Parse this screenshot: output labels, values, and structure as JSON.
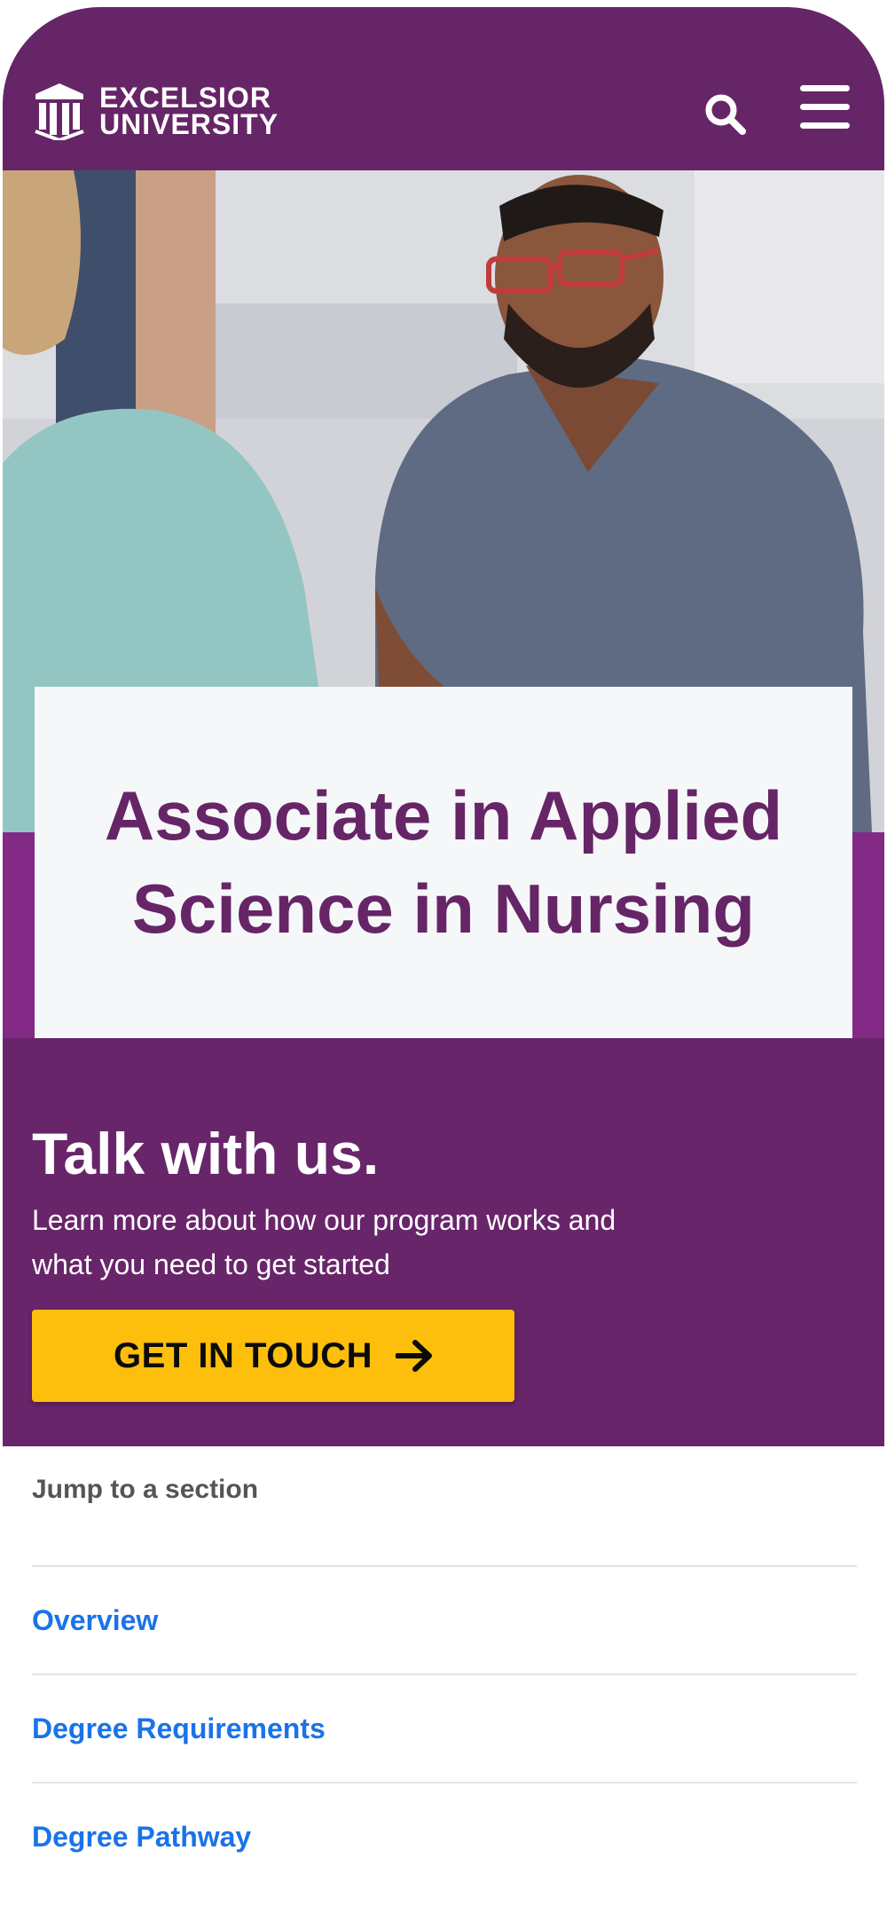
{
  "header": {
    "logo_line1": "EXCELSIOR",
    "logo_line2": "UNIVERSITY",
    "search_icon": "search-icon",
    "menu_icon": "hamburger-menu-icon"
  },
  "hero": {
    "image_subject": "nurse in scrubs talking with patient",
    "title": "Associate in Applied Science in Nursing"
  },
  "cta": {
    "heading": "Talk with us.",
    "body": "Learn more about how our program works and what you need to get started",
    "button_label": "GET IN TOUCH",
    "button_icon": "arrow-right-icon"
  },
  "jump": {
    "title": "Jump to a section",
    "links": [
      "Overview",
      "Degree Requirements",
      "Degree Pathway"
    ]
  },
  "colors": {
    "brand_purple": "#662567",
    "accent_purple": "#822a86",
    "button_yellow": "#fdbf0b",
    "link_blue": "#1a73e8"
  }
}
